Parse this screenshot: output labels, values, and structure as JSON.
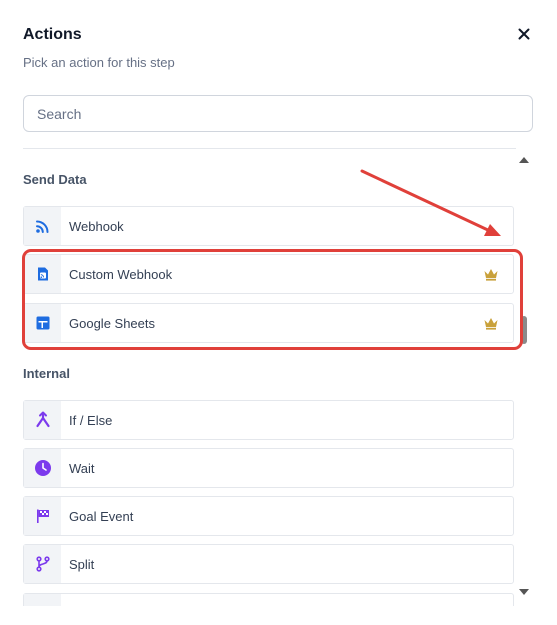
{
  "panel": {
    "title": "Actions",
    "subtitle": "Pick an action for this step",
    "close_icon": "close-icon"
  },
  "search": {
    "placeholder": "Search",
    "value": ""
  },
  "sections": [
    {
      "title": "Send Data",
      "items": [
        {
          "label": "Webhook",
          "icon": "rss-icon",
          "icon_color": "#1e6ce0",
          "premium": false
        },
        {
          "label": "Custom Webhook",
          "icon": "document-rss-icon",
          "icon_color": "#1e6ce0",
          "premium": true
        },
        {
          "label": "Google Sheets",
          "icon": "google-sheets-icon",
          "icon_color": "#1e6ce0",
          "premium": true
        }
      ]
    },
    {
      "title": "Internal",
      "items": [
        {
          "label": "If / Else",
          "icon": "branch-icon",
          "icon_color": "#7c3aed",
          "premium": false
        },
        {
          "label": "Wait",
          "icon": "clock-icon",
          "icon_color": "#7c3aed",
          "premium": false
        },
        {
          "label": "Goal Event",
          "icon": "checkered-flag-icon",
          "icon_color": "#7c3aed",
          "premium": false
        },
        {
          "label": "Split",
          "icon": "split-icon",
          "icon_color": "#7c3aed",
          "premium": false
        }
      ]
    }
  ],
  "colors": {
    "premium_crown": "#c9a13a",
    "highlight": "#e0403a",
    "send_data_icon": "#1e6ce0",
    "internal_icon": "#7c3aed"
  }
}
